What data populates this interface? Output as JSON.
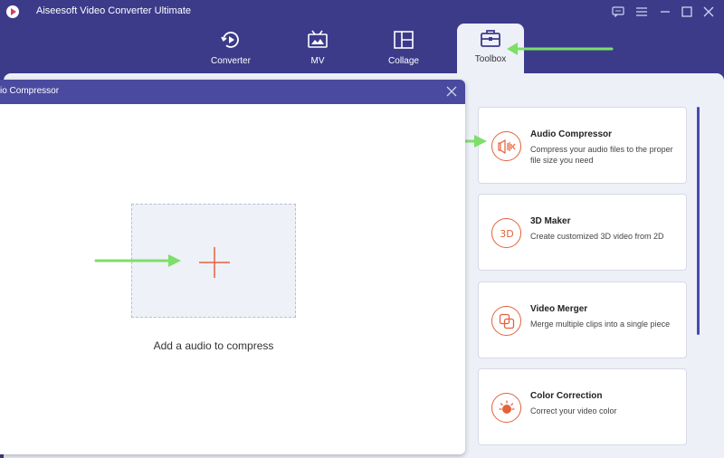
{
  "app": {
    "title": "Aiseesoft Video Converter Ultimate",
    "logo_icon": "app-logo-icon"
  },
  "window_controls": [
    "feedback-icon",
    "menu-icon",
    "minimize-icon",
    "maximize-icon",
    "close-icon"
  ],
  "tabs": [
    {
      "label": "Converter",
      "icon": "converter-icon",
      "active": false
    },
    {
      "label": "MV",
      "icon": "mv-icon",
      "active": false
    },
    {
      "label": "Collage",
      "icon": "collage-icon",
      "active": false
    },
    {
      "label": "Toolbox",
      "icon": "toolbox-icon",
      "active": true
    }
  ],
  "dialog": {
    "title": "io Compressor",
    "drop_label": "Add a audio to compress"
  },
  "tools": [
    {
      "name": "Audio Compressor",
      "desc": "Compress your audio files to the proper file size you need",
      "icon": "audio-compressor-icon"
    },
    {
      "name": "3D Maker",
      "desc": "Create customized 3D video from 2D",
      "icon": "3d-maker-icon"
    },
    {
      "name": "Video Merger",
      "desc": "Merge multiple clips into a single piece",
      "icon": "video-merger-icon"
    },
    {
      "name": "Color Correction",
      "desc": "Correct your video color",
      "icon": "color-correction-icon"
    }
  ],
  "colors": {
    "background": "#3c3b8a",
    "panel": "#eef0f8",
    "dialog_header": "#4a4aa0",
    "accent": "#e3623b",
    "annotation_arrow": "#7ddf6a"
  }
}
